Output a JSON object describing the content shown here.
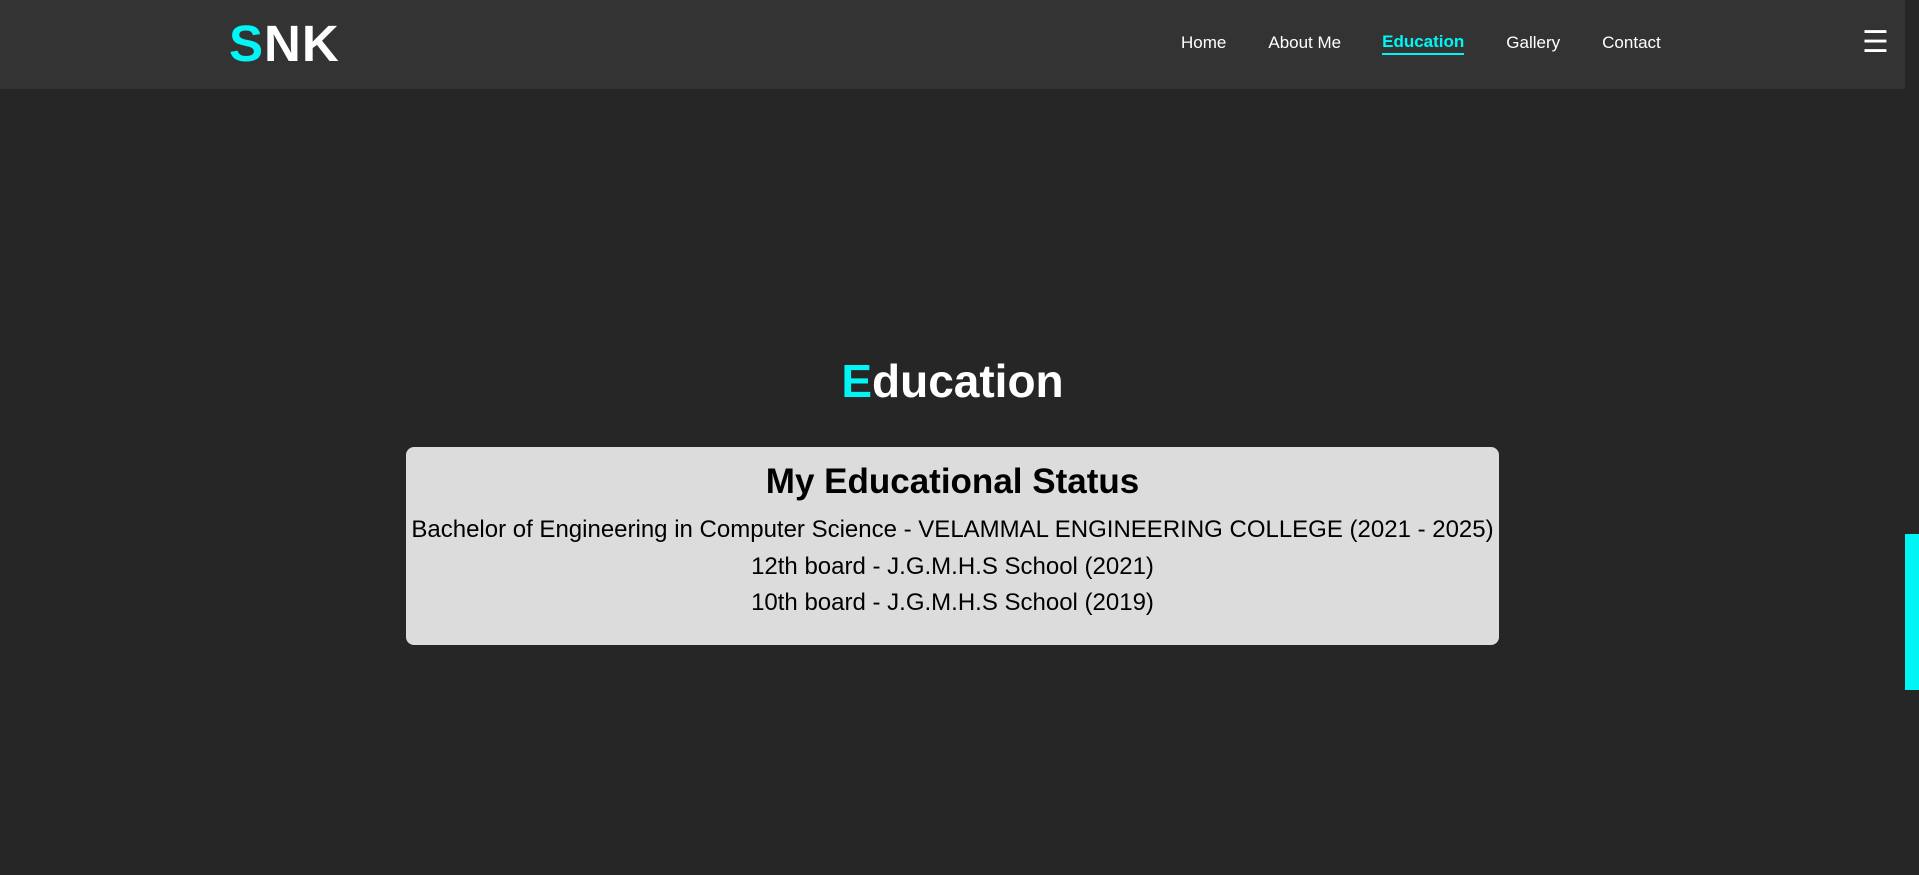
{
  "header": {
    "logo_accent": "S",
    "logo_rest": "NK",
    "nav": [
      {
        "label": "Home"
      },
      {
        "label": "About Me"
      },
      {
        "label": "Education"
      },
      {
        "label": "Gallery"
      },
      {
        "label": "Contact"
      }
    ],
    "active_nav": "Education",
    "menu_icon": "hamburger-menu-icon"
  },
  "main": {
    "title_accent": "E",
    "title_rest": "ducation",
    "card": {
      "title": "My Educational Status",
      "lines": [
        "Bachelor of Engineering in Computer Science - VELAMMAL ENGINEERING COLLEGE (2021 - 2025)",
        "12th board - J.G.M.H.S School (2021)",
        "10th board - J.G.M.H.S School (2019)"
      ]
    }
  },
  "colors": {
    "accent": "#00f5f5",
    "background": "#262626",
    "header_bg": "#333333",
    "card_bg": "#dcdcdc"
  }
}
